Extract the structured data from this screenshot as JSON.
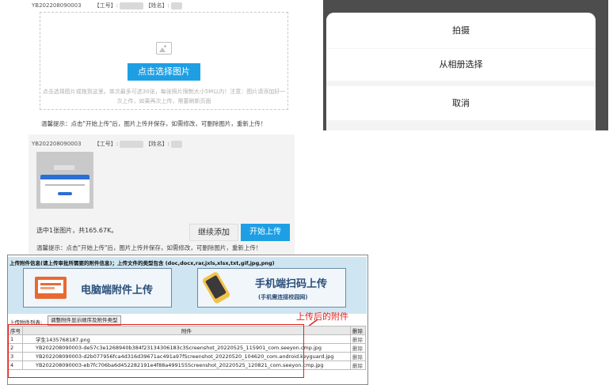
{
  "first_record": {
    "id": "YB202208090003",
    "work_no_label": "【工号】:",
    "name_label": "【姓名】:",
    "select_button": "点击选择图片",
    "hint": "点击选择图片或拖到这里。单次最多可选30张，每张照片限制大小5M以内！注意：图片请添加好一次上传，如果再次上传，需要刷新页面",
    "warning": "温馨提示：点击\"开始上传\"后，图片上传并保存，如需修改，可删除图片，重新上传！"
  },
  "second_record": {
    "id": "YB202208090003",
    "work_no_label": "【工号】:",
    "name_label": "【姓名】:",
    "summary": "选中1张图片，共165.67K。",
    "continue_button": "继续添加",
    "start_button": "开始上传",
    "warning": "温馨提示：点击\"开始上传\"后，图片上传并保存，如需修改，可删除图片，重新上传！"
  },
  "action_sheet": {
    "items": [
      "拍摄",
      "从相册选择"
    ],
    "cancel": "取消"
  },
  "upload": {
    "info": "上传附件信息(请上传审批所需要的附件信息)；上传文件的类型包含 (doc,docx,rar,jxls,xlsx,txt,gif,jpg,png)",
    "pc_button": "电脑端附件上传",
    "mobile_button": "手机端扫码上传",
    "mobile_sub": "(手机需连接校园网)",
    "list_label": "上传附件列表:",
    "adjust_button": "调整附件显示顺序及附件类型",
    "annotation": "上传后的附件",
    "columns": [
      "序号",
      "附件",
      "删除"
    ],
    "rows": [
      {
        "no": "1",
        "file": "学生1435768187.png",
        "del": "删除"
      },
      {
        "no": "2",
        "file": "YB202208090003-de57c3e1268940b384f23134306183c3Screenshot_20220525_115901_com.seeyon.cmp.jpg",
        "del": "删除"
      },
      {
        "no": "3",
        "file": "YB202208090003-d2b077956fca4d316d39671ac491a97fScreenshot_20220520_104620_com.android.keyguard.jpg",
        "del": "删除"
      },
      {
        "no": "4",
        "file": "YB202208090003-eb7fc706ba6d452282191e4f88a499155Screenshot_20220525_120821_com.seeyon.cmp.jpg",
        "del": "删除"
      }
    ]
  },
  "colors": {
    "accent": "#1e9fe4",
    "annotation": "#e0221c"
  }
}
